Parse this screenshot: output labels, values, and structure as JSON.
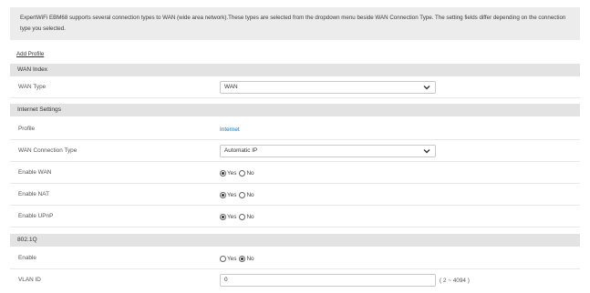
{
  "description": "ExpertWiFi EBM68 supports several connection types to WAN (wide area network).These types are selected from the dropdown menu beside WAN Connection Type. The setting fields differ depending on the connection type you selected.",
  "add_profile": "Add Profile",
  "sections": {
    "wan_index": "WAN Index",
    "internet_settings": "Internet Settings",
    "dot1q": "802.1Q"
  },
  "wan_type": {
    "label": "WAN Type",
    "value": "WAN"
  },
  "profile": {
    "label": "Profile",
    "value": "Internet"
  },
  "wan_connection_type": {
    "label": "WAN Connection Type",
    "value": "Automatic IP"
  },
  "enable_wan": {
    "label": "Enable WAN",
    "yes": "Yes",
    "no": "No",
    "selected": "yes"
  },
  "enable_nat": {
    "label": "Enable NAT",
    "yes": "Yes",
    "no": "No",
    "selected": "yes"
  },
  "enable_upnp": {
    "label": "Enable UPnP",
    "yes": "Yes",
    "no": "No",
    "selected": "yes"
  },
  "vlan_enable": {
    "label": "Enable",
    "yes": "Yes",
    "no": "No",
    "selected": "no"
  },
  "vlan_id": {
    "label": "VLAN ID",
    "value": "0",
    "range_hint": "( 2 ~ 4094 )"
  },
  "icons": {
    "dropdown": "chevron-down-icon"
  },
  "colors": {
    "link": "#1a73c9",
    "section_bg": "#e3e3e3",
    "desc_bg": "#ececec"
  }
}
